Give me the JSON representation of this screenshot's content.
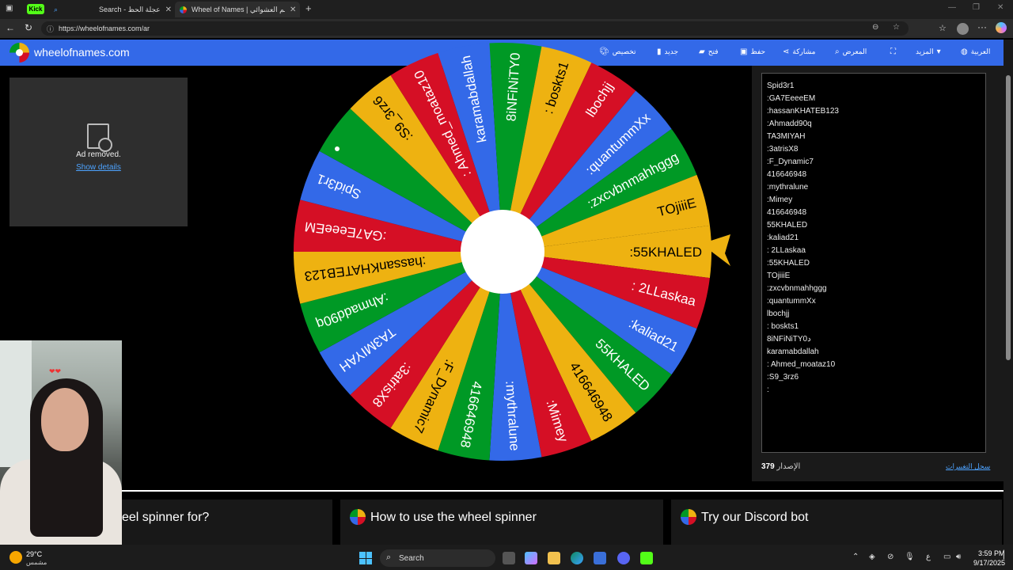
{
  "browser": {
    "tabs": [
      {
        "label": "Search - عجلة الحظ",
        "badge": "Kick"
      },
      {
        "label": "Wheel of Names | الاسم العشوائي"
      }
    ],
    "url": "https://wheelofnames.com/ar"
  },
  "site": {
    "name": "wheelofnames.com",
    "nav": [
      {
        "label": "تخصيص",
        "icon": "palette-icon"
      },
      {
        "label": "جديد",
        "icon": "new-file-icon"
      },
      {
        "label": "فتح",
        "icon": "folder-icon"
      },
      {
        "label": "حفظ",
        "icon": "save-icon"
      },
      {
        "label": "مشاركة",
        "icon": "share-icon"
      },
      {
        "label": "المعرض",
        "icon": "search-icon"
      },
      {
        "label": "",
        "icon": "fullscreen-icon"
      },
      {
        "label": "المزيد",
        "icon": "chevron-down-icon"
      },
      {
        "label": "العربية",
        "icon": "globe-icon"
      }
    ]
  },
  "ad": {
    "removed_text": "Ad removed.",
    "details_link": "Show details"
  },
  "wheel": {
    "colors": [
      "#eeb211",
      "#d50f25",
      "#3369e8",
      "#009925"
    ],
    "segments": [
      ":55KHALED",
      ": 2LLaskaa",
      ":kaliad21",
      "55KHALED",
      "416646948",
      ":Mimey",
      ":mythralune",
      "416646948",
      ":F_Dynamic7",
      ":3atrisX8",
      "TA3MIYAH",
      ":Ahmadd90q",
      ":hassanKHATEB123",
      ":GA7EeeeEM",
      "Spid3r1",
      "",
      ":S9_3rz6",
      ": Ahmed_moataz10",
      "karamabdallah",
      "8iNFiNiTY0",
      ": boskts1",
      "lbochjj",
      ":quantummXx",
      ":zxcvbnmahhggg",
      "TOjiiiE"
    ]
  },
  "entries": [
    "Spid3r1",
    ":GA7EeeeEM",
    ":hassanKHATEB123",
    ":Ahmadd90q",
    "TA3MIYAH",
    ":3atrisX8",
    ":F_Dynamic7",
    "416646948",
    ":mythralune",
    ":Mimey",
    "416646948",
    "55KHALED",
    ":kaliad21",
    ": 2LLaskaa",
    ":55KHALED",
    "TOjiiiE",
    ":zxcvbnmahhggg",
    ":quantummXx",
    "lbochjj",
    ": boskts1",
    "8iNFiNiTY0د",
    "karamabdallah",
    ": Ahmed_moataz10",
    ":S9_3rz6",
    ":"
  ],
  "version": {
    "label": "الإصدار",
    "number": "379"
  },
  "changelog": "سجل التغييرات",
  "cards": [
    {
      "title": "eel spinner for?"
    },
    {
      "title": "How to use the wheel spinner"
    },
    {
      "title": "Try our Discord bot"
    }
  ],
  "taskbar": {
    "weather_temp": "29°C",
    "weather_desc": "مشمس",
    "search": "Search",
    "lang": "ع",
    "time": "3:59 PM",
    "date": "9/17/2025"
  }
}
